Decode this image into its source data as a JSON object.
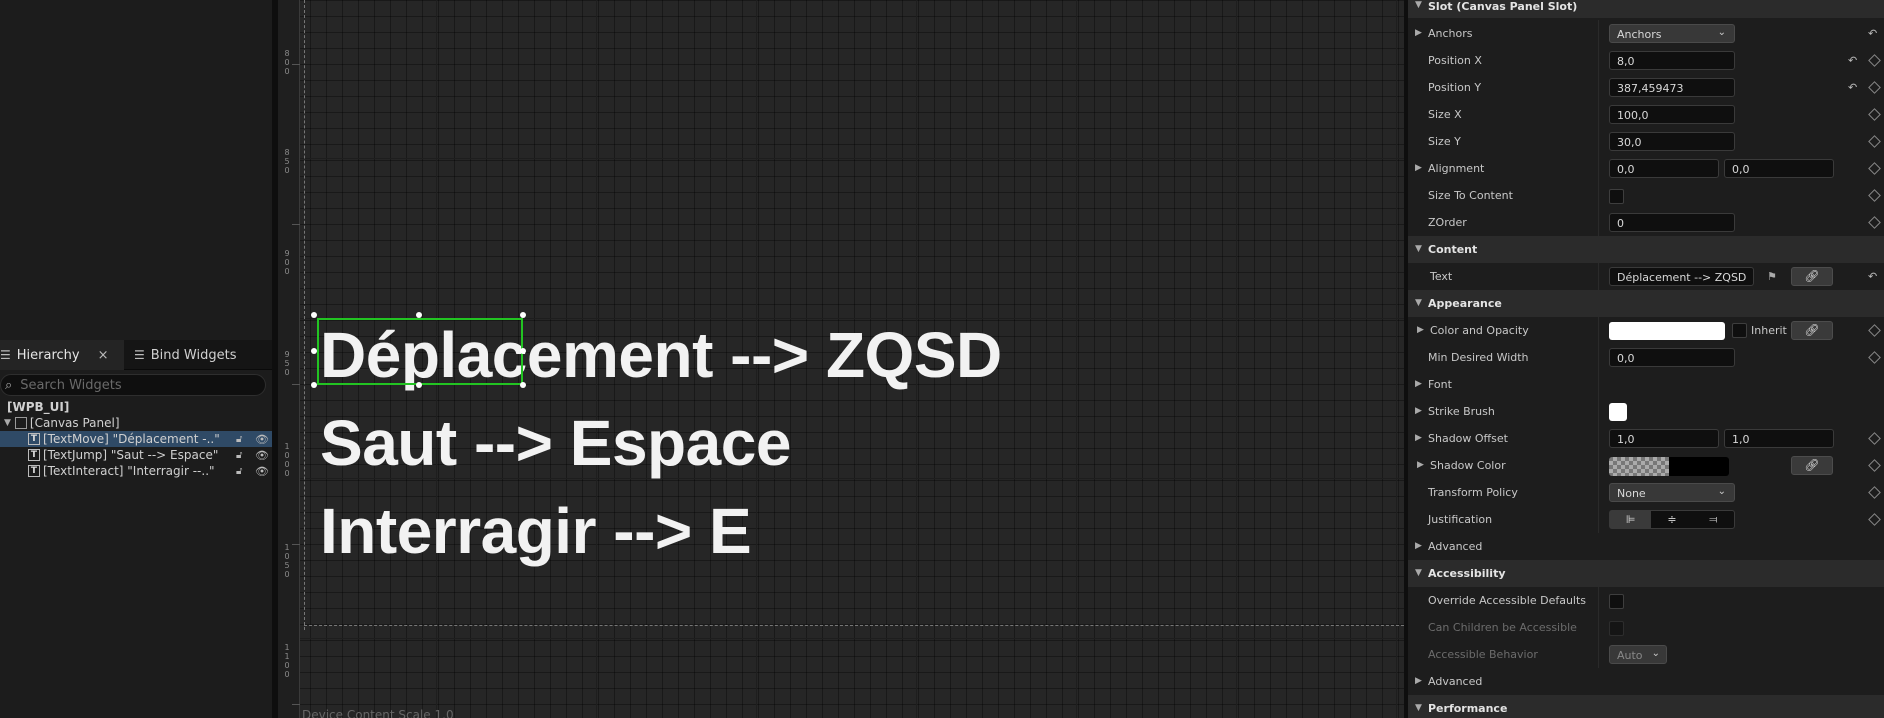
{
  "hierarchy": {
    "tabs": {
      "hierarchy": "Hierarchy",
      "bind_widgets": "Bind Widgets",
      "close": "×"
    },
    "search_placeholder": "Search Widgets",
    "root": "[WPB_UI]",
    "canvas": "[Canvas Panel]",
    "items": [
      {
        "label": "[TextMove] \"Déplacement -..\"",
        "selected": true
      },
      {
        "label": "[TextJump] \"Saut --> Espace\"",
        "selected": false
      },
      {
        "label": "[TextInteract] \"Interragir --..\"",
        "selected": false
      }
    ]
  },
  "designer": {
    "texts": [
      "Déplacement --> ZQSD",
      "Saut --> Espace",
      "Interragir --> E"
    ],
    "ruler": [
      "8\n0\n0",
      "8\n5\n0",
      "9\n0\n0",
      "9\n5\n0",
      "1\n0\n0\n0",
      "1\n0\n5\n0",
      "1\n1\n0\n0"
    ],
    "footer": "Device Content Scale 1.0"
  },
  "details": {
    "slot": {
      "title": "Slot (Canvas Panel Slot)",
      "anchors_label": "Anchors",
      "anchors_value": "Anchors",
      "position_x_label": "Position X",
      "position_x": "8,0",
      "position_y_label": "Position Y",
      "position_y": "387,459473",
      "size_x_label": "Size X",
      "size_x": "100,0",
      "size_y_label": "Size Y",
      "size_y": "30,0",
      "alignment_label": "Alignment",
      "alignment_x": "0,0",
      "alignment_y": "0,0",
      "size_to_content_label": "Size To Content",
      "zorder_label": "ZOrder",
      "zorder": "0"
    },
    "content": {
      "title": "Content",
      "text_label": "Text",
      "text_value": "Déplacement --> ZQSD"
    },
    "appearance": {
      "title": "Appearance",
      "color_label": "Color and Opacity",
      "inherit": "Inherit",
      "min_width_label": "Min Desired Width",
      "min_width": "0,0",
      "font_label": "Font",
      "strike_label": "Strike Brush",
      "shadow_offset_label": "Shadow Offset",
      "shadow_offset_x": "1,0",
      "shadow_offset_y": "1,0",
      "shadow_color_label": "Shadow Color",
      "transform_label": "Transform Policy",
      "transform_value": "None",
      "justification_label": "Justification",
      "advanced": "Advanced"
    },
    "accessibility": {
      "title": "Accessibility",
      "override_label": "Override Accessible Defaults",
      "children_label": "Can Children be Accessible",
      "behavior_label": "Accessible Behavior",
      "behavior_value": "Auto",
      "advanced": "Advanced"
    },
    "performance": {
      "title": "Performance"
    }
  },
  "colors": {
    "selection_green": "#22c422",
    "tree_selected": "#2f4a66",
    "text_white": "#f2f2f2"
  }
}
